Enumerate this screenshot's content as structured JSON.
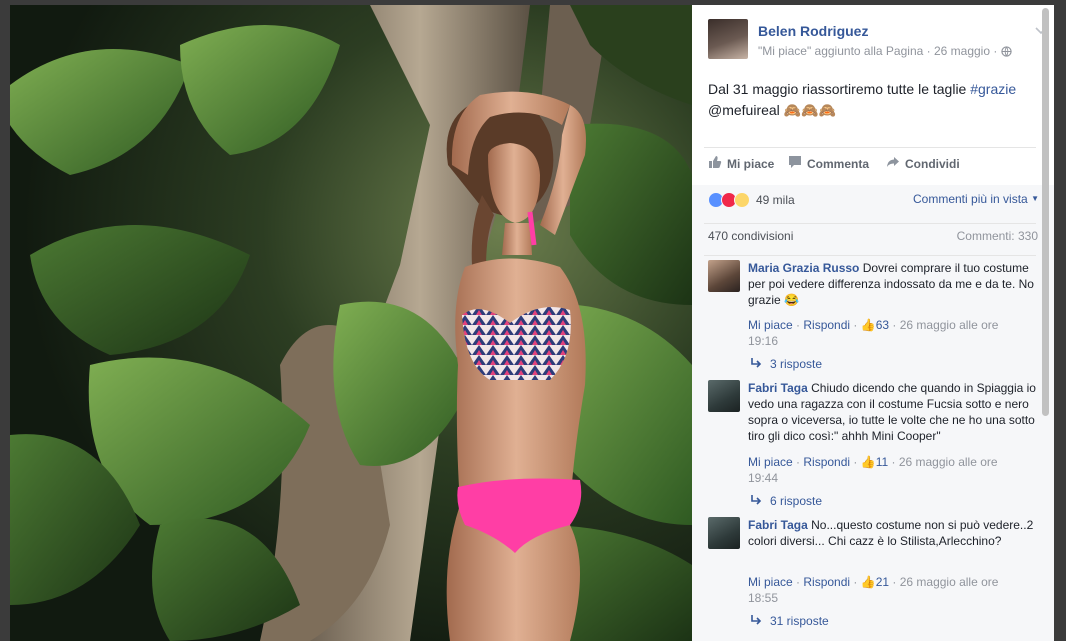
{
  "post": {
    "author": "Belen Rodriguez",
    "meta_like": "\"Mi piace\" aggiunto alla Pagina",
    "meta_sep": " · ",
    "meta_date": "26 maggio",
    "meta_sep2": " · ",
    "text_before": "Dal 31 maggio riassortiremo tutte le taglie ",
    "hashtag": "#grazie",
    "text_after": "@mefuireal 🙈🙈🙈"
  },
  "actions": {
    "like": "Mi piace",
    "comment": "Commenta",
    "share": "Condividi"
  },
  "reactions": {
    "count": "49 mila",
    "top_comments": "Commenti più in vista"
  },
  "stats": {
    "shares": "470 condivisioni",
    "comments": "Commenti: 330"
  },
  "comments": [
    {
      "name": "Maria Grazia Russo",
      "text": " Dovrei comprare il tuo costume per poi vedere differenza indossato da me e da te. No grazie 😂",
      "like": "Mi piace",
      "reply": "Rispondi",
      "likes": "63",
      "time": "26 maggio alle ore 19:16",
      "replies": "3 risposte"
    },
    {
      "name": "Fabri Taga",
      "text": " Chiudo dicendo che quando in Spiaggia io vedo una ragazza con il costume Fucsia sotto e nero sopra o viceversa, io tutte le volte che ne ho una sotto tiro gli dico così:\" ahhh Mini Cooper\"",
      "like": "Mi piace",
      "reply": "Rispondi",
      "likes": "11",
      "time": "26 maggio alle ore 19:44",
      "replies": "6 risposte"
    },
    {
      "name": "Fabri Taga",
      "text": " No...questo costume non si può vedere..2 colori diversi... Chi cazz è lo Stilista,Arlecchino?",
      "like": "Mi piace",
      "reply": "Rispondi",
      "likes": "21",
      "time": "26 maggio alle ore 18:55",
      "replies": "31 risposte"
    }
  ],
  "colors": {
    "link": "#365899",
    "like_blue": "#5890ff",
    "love_red": "#f0284a",
    "wow_yellow": "#fcd669",
    "bikini_pink": "#ff3ea5"
  },
  "icons": [
    "globe-icon",
    "chevron-down-icon",
    "thumb-up-icon",
    "comment-icon",
    "share-icon",
    "reply-arrow-icon",
    "like-reaction-icon",
    "love-reaction-icon",
    "wow-reaction-icon"
  ]
}
